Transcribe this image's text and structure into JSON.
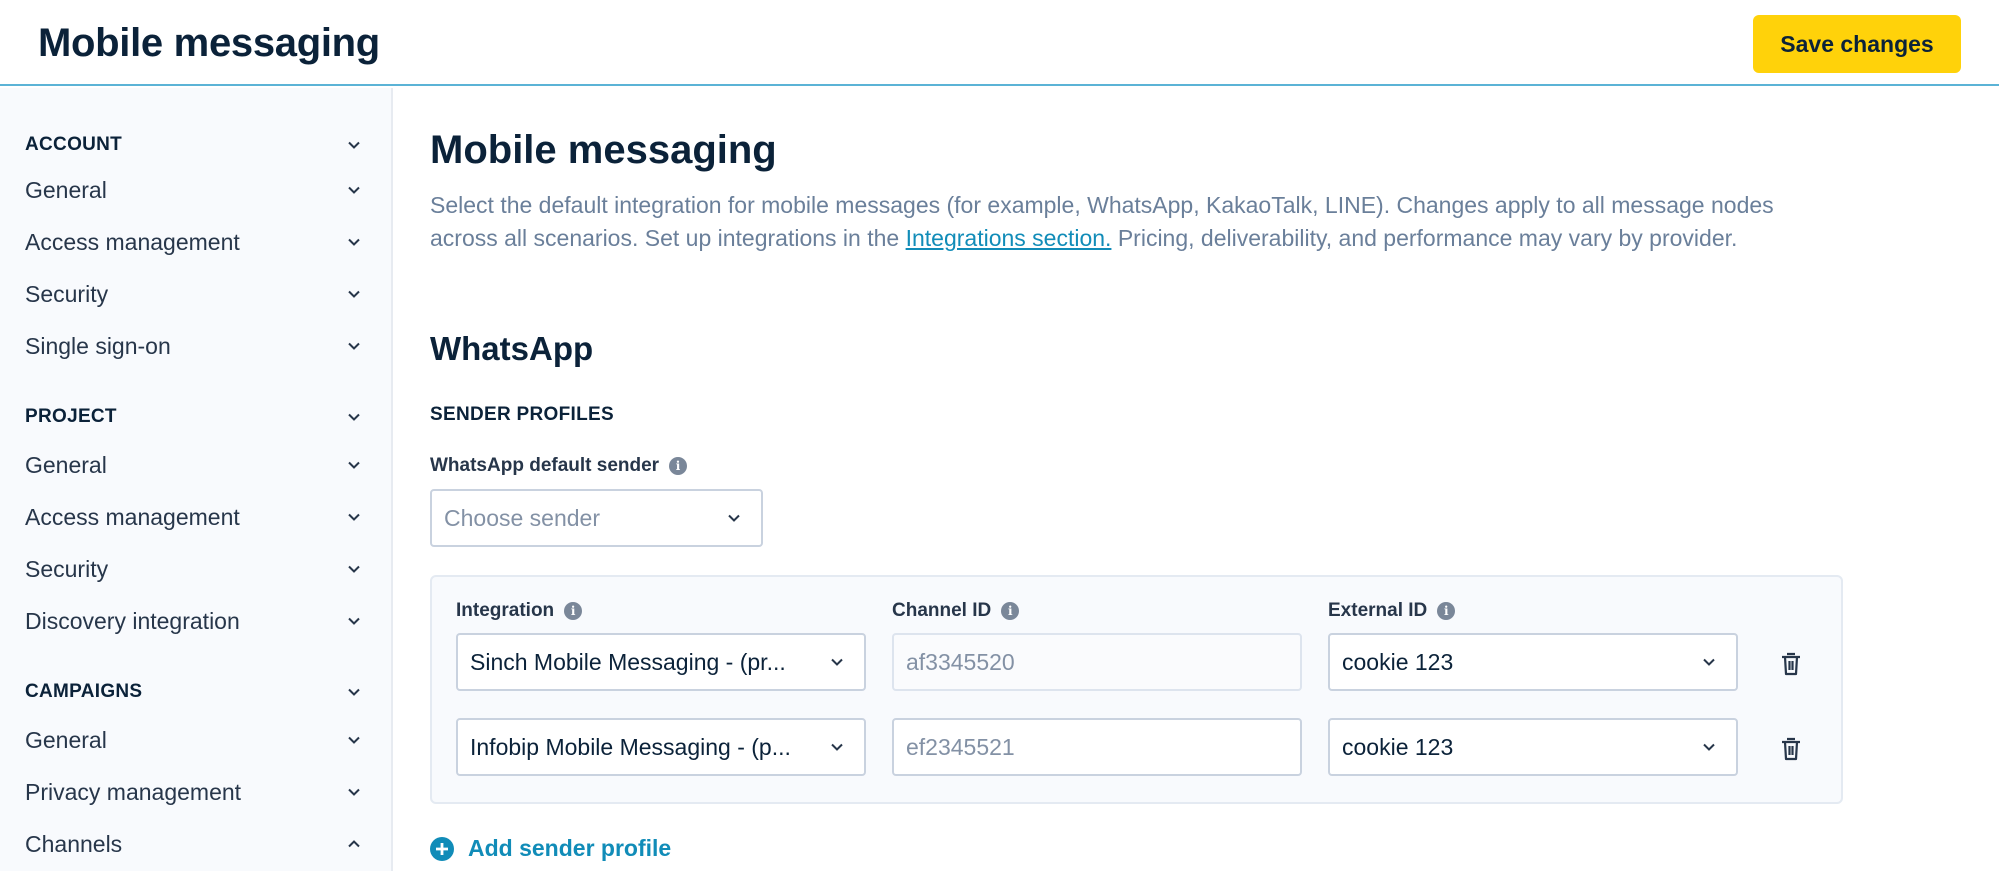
{
  "header": {
    "title": "Mobile messaging",
    "save_label": "Save changes"
  },
  "sidebar": {
    "sections": [
      {
        "label": "ACCOUNT",
        "items": [
          "General",
          "Access management",
          "Security",
          "Single sign-on"
        ]
      },
      {
        "label": "PROJECT",
        "items": [
          "General",
          "Access management",
          "Security",
          "Discovery integration"
        ]
      },
      {
        "label": "CAMPAIGNS",
        "items": [
          "General",
          "Privacy management",
          "Channels"
        ]
      }
    ]
  },
  "main": {
    "title": "Mobile messaging",
    "description_before": "Select the default integration for mobile messages (for example, WhatsApp, KakaoTalk, LINE). Changes apply to all message nodes across all scenarios. Set up integrations in the ",
    "description_link": "Integrations section.",
    "description_after": " Pricing, deliverability, and performance may vary by provider.",
    "section_title": "WhatsApp",
    "subheading": "SENDER PROFILES",
    "default_sender_label": "WhatsApp default sender",
    "default_sender_placeholder": "Choose sender",
    "columns": [
      "Integration",
      "Channel ID",
      "External ID"
    ],
    "rows": [
      {
        "integration": "Sinch Mobile Messaging - (pr...",
        "channel_id": "af3345520",
        "external_id": "cookie 123"
      },
      {
        "integration": "Infobip Mobile Messaging - (p...",
        "channel_id": "ef2345521",
        "external_id": "cookie 123"
      }
    ],
    "add_label": "Add sender profile"
  },
  "colors": {
    "accent": "#ffd20a",
    "link": "#118cb8",
    "header_border": "#5bb3d6"
  },
  "icons": [
    "chevron-down-icon",
    "chevron-up-icon",
    "info-icon",
    "trash-icon",
    "plus-circle-icon"
  ]
}
